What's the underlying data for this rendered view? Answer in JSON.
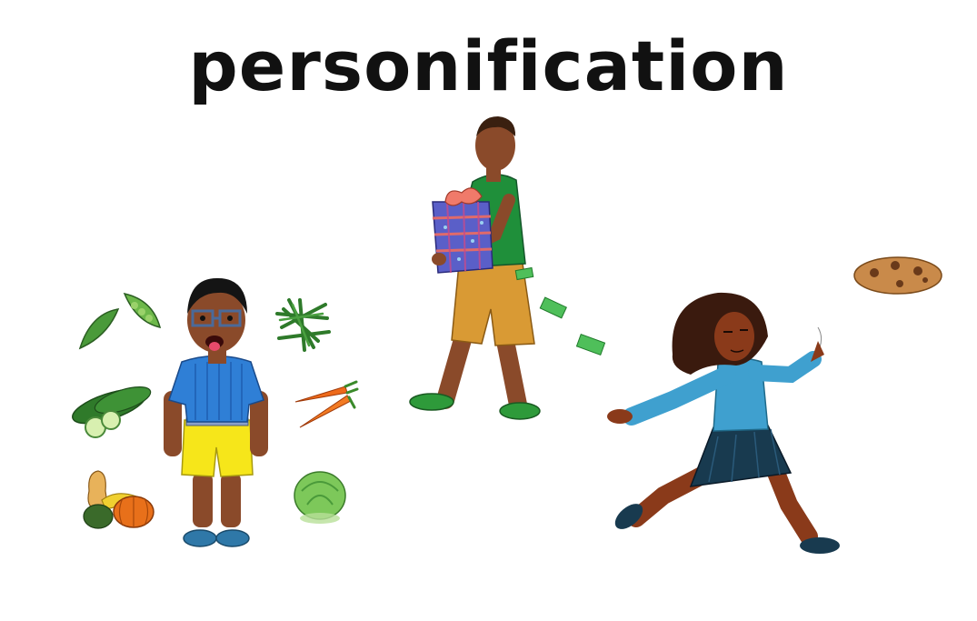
{
  "title": "personification",
  "colors": {
    "text": "#111111",
    "background": "#ffffff",
    "boy_shirt": "#2f7fd6",
    "boy_shorts": "#f6e61a",
    "walker_shirt": "#1f8f3a",
    "walker_shorts": "#d99a34",
    "gift_box": "#5a5fc8",
    "girl_top": "#3fa0cf",
    "girl_skirt": "#183a4f",
    "skin": "#8a4a2a",
    "cookie": "#c98a4a",
    "money": "#4fbf5a"
  },
  "illustrations": {
    "left_group": "boy-surrounded-by-vegetables",
    "center_figure": "boy-carrying-gift-dropping-money",
    "right_figure": "girl-chasing-flying-cookie"
  }
}
